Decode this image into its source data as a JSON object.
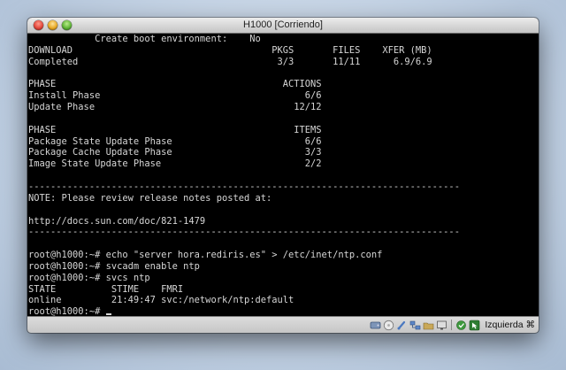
{
  "window": {
    "title": "H1000 [Corriendo]"
  },
  "terminal": {
    "lines": [
      "            Create boot environment:    No",
      "DOWNLOAD                                    PKGS       FILES    XFER (MB)",
      "Completed                                    3/3       11/11      6.9/6.9",
      "",
      "PHASE                                         ACTIONS",
      "Install Phase                                     6/6",
      "Update Phase                                    12/12",
      "",
      "PHASE                                           ITEMS",
      "Package State Update Phase                        6/6",
      "Package Cache Update Phase                        3/3",
      "Image State Update Phase                          2/2",
      "",
      "------------------------------------------------------------------------------",
      "NOTE: Please review release notes posted at:",
      "",
      "http://docs.sun.com/doc/821-1479",
      "------------------------------------------------------------------------------",
      "",
      "root@h1000:~# echo \"server hora.rediris.es\" > /etc/inet/ntp.conf",
      "root@h1000:~# svcadm enable ntp",
      "root@h1000:~# svcs ntp",
      "STATE          STIME    FMRI",
      "online         21:49:47 svc:/network/ntp:default",
      "root@h1000:~# "
    ]
  },
  "statusbar": {
    "icons": [
      "hard-disk-icon",
      "optical-drive-icon",
      "usb-icon",
      "network-icon",
      "shared-folders-icon",
      "display-icon",
      "virtualization-icon",
      "mouse-integration-icon"
    ],
    "host_key": "Izquierda ⌘"
  }
}
